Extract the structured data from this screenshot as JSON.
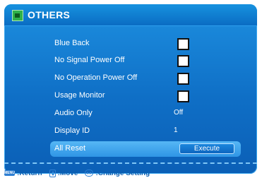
{
  "header": {
    "title": "OTHERS",
    "icon": "others-menu-icon"
  },
  "items": [
    {
      "label": "Blue Back",
      "control": "checkbox"
    },
    {
      "label": "No Signal Power Off",
      "control": "checkbox"
    },
    {
      "label": "No Operation Power Off",
      "control": "checkbox"
    },
    {
      "label": "Usage Monitor",
      "control": "checkbox"
    },
    {
      "label": "Audio Only",
      "value": "Off"
    },
    {
      "label": "Display ID",
      "value": "1"
    },
    {
      "label": "All Reset",
      "button": "Execute",
      "selected": true
    }
  ],
  "footer": {
    "menu_key_label": "MENU",
    "return_label": ":Return",
    "move_label": ":Move",
    "change_label": ":Change Setting"
  },
  "colors": {
    "panel": "#0f6fc6",
    "highlight": "#3fa6ef",
    "footer_text": "#0d5fb1"
  }
}
